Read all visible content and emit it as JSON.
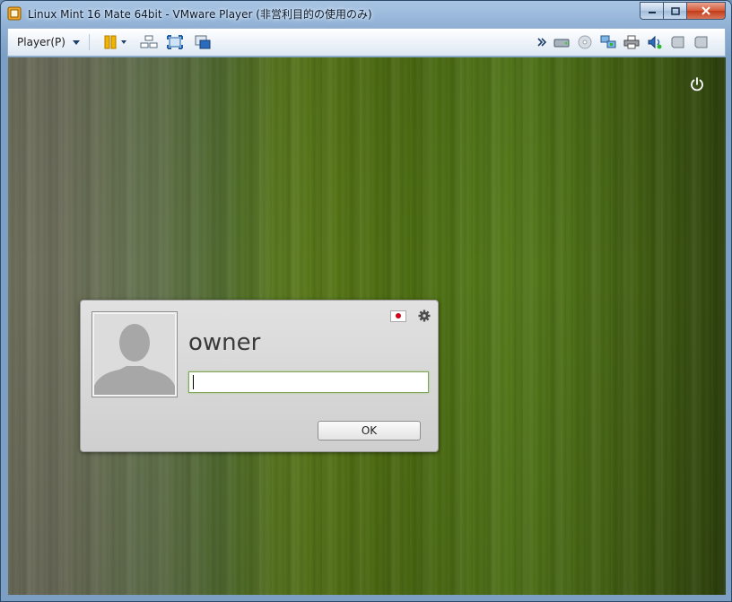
{
  "window": {
    "title": "Linux Mint 16 Mate 64bit - VMware Player (非営利目的の使用のみ)"
  },
  "toolbar": {
    "player_menu_label": "Player(P)",
    "icons": [
      "pause-icon",
      "send-ctrl-alt-del-icon",
      "full-screen-icon",
      "unity-icon",
      "hard-disk-icon",
      "cd-drive-icon",
      "network-adapter-icon",
      "printer-icon",
      "sound-card-icon",
      "removable-device-icon",
      "removable-device-icon-2"
    ]
  },
  "login_dialog": {
    "username": "owner",
    "password_value": "",
    "ok_label": "OK",
    "keyboard_layout": "jp"
  },
  "colors": {
    "accent_green": "#4f7215",
    "title_bar_blue": "#8fb0d4"
  }
}
